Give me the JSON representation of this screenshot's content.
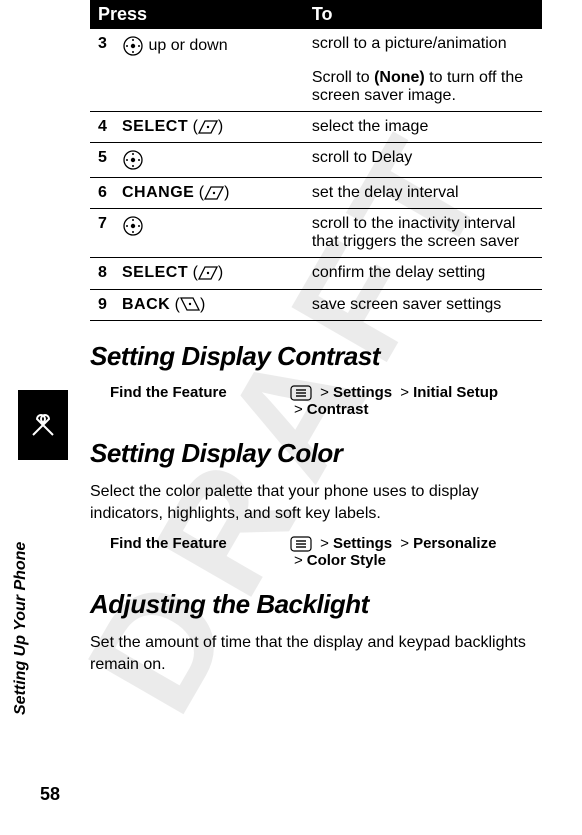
{
  "watermark": "DRAFT",
  "side_label": "Setting Up Your Phone",
  "page_number": "58",
  "table": {
    "header_press": "Press",
    "header_to": "To",
    "rows": [
      {
        "step": "3",
        "press_label": "up or down",
        "to": "scroll to a picture/animation"
      },
      {
        "step": "",
        "press_label": "",
        "to_prefix": "Scroll to ",
        "to_bold": "(None)",
        "to_suffix": " to turn off the screen saver image."
      },
      {
        "step": "4",
        "press_label": "SELECT",
        "to": "select the image"
      },
      {
        "step": "5",
        "press_label": "",
        "to": "scroll to Delay"
      },
      {
        "step": "6",
        "press_label": "CHANGE",
        "to": "set the delay interval"
      },
      {
        "step": "7",
        "press_label": "",
        "to": "scroll to the inactivity interval that triggers the screen saver"
      },
      {
        "step": "8",
        "press_label": "SELECT",
        "to": "confirm the delay setting"
      },
      {
        "step": "9",
        "press_label": "BACK",
        "to": "save screen saver settings"
      }
    ]
  },
  "sections": {
    "contrast": {
      "heading": "Setting Display Contrast",
      "find_label": "Find the Feature",
      "path1a": "Settings",
      "path1b": "Initial Setup",
      "path2": "Contrast"
    },
    "color": {
      "heading": "Setting Display Color",
      "body": "Select the color palette that your phone uses to display indicators, highlights, and soft key labels.",
      "find_label": "Find the Feature",
      "path1a": "Settings",
      "path1b": "Personalize",
      "path2": "Color Style"
    },
    "backlight": {
      "heading": "Adjusting the Backlight",
      "body": "Set the amount of time that the display and keypad backlights remain on."
    }
  },
  "glyphs": {
    "gt": ">"
  }
}
